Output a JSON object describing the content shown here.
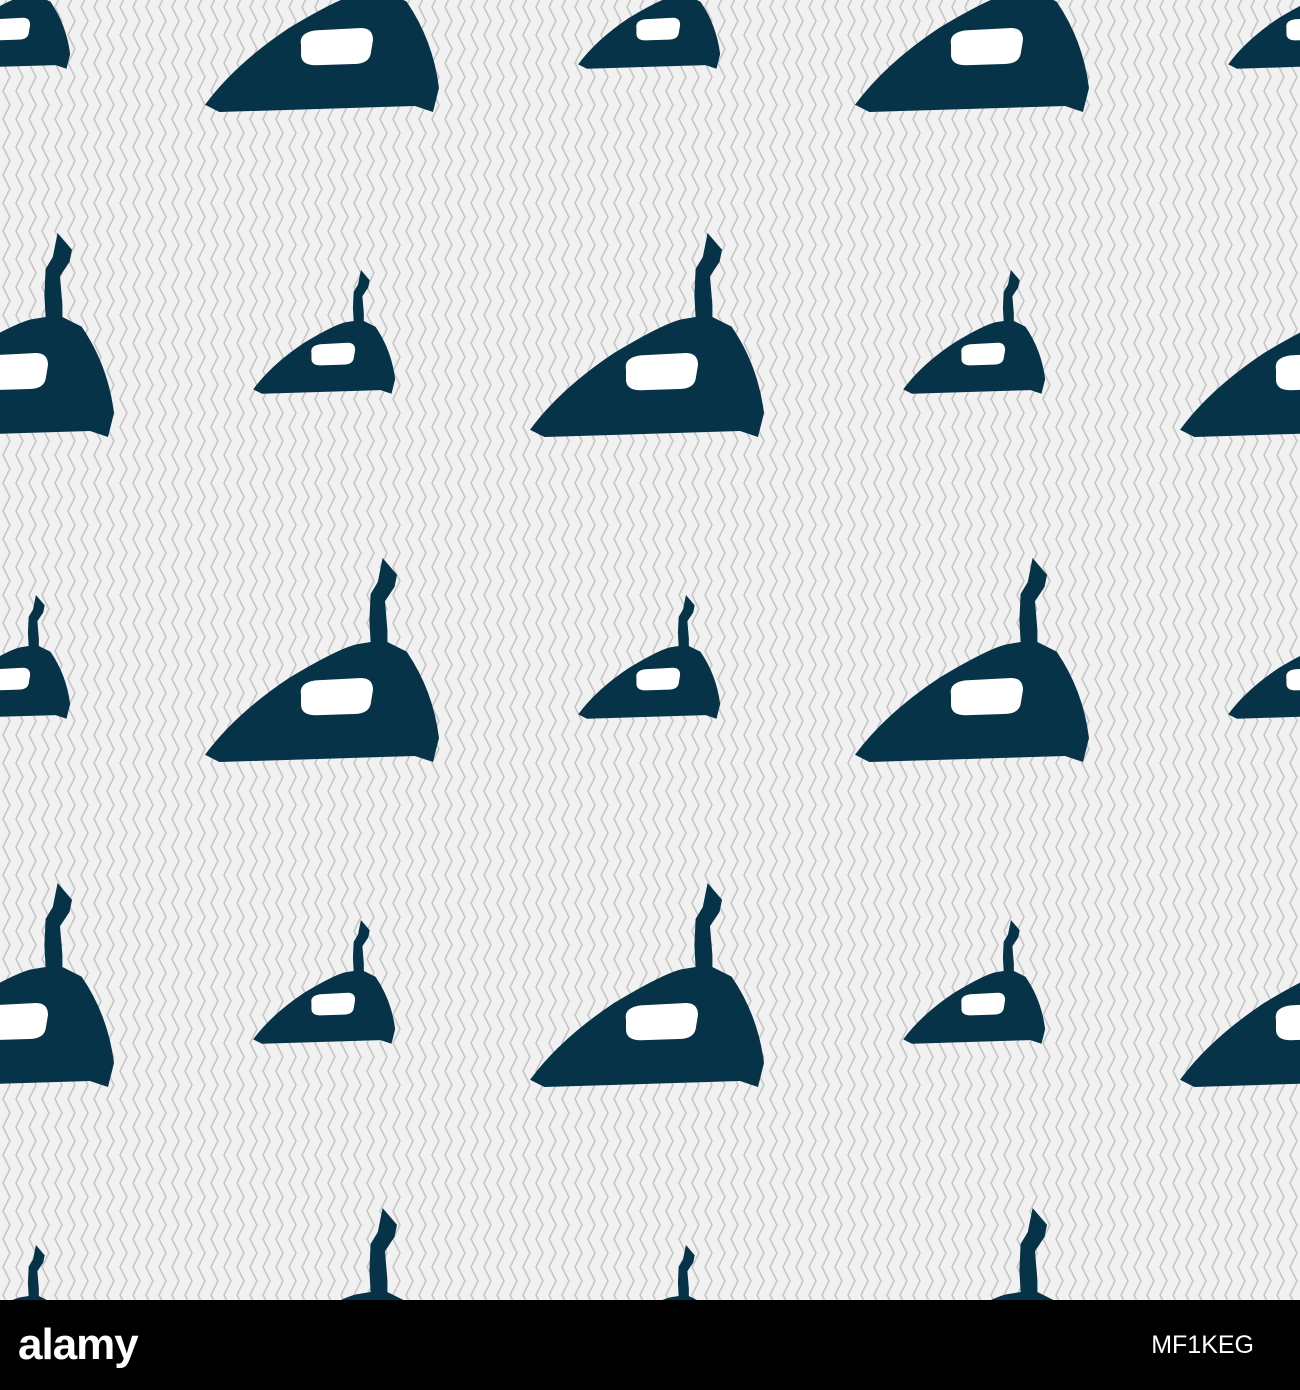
{
  "colors": {
    "background": "#f1f1f1",
    "zigzag_stroke": "#c6c6c6",
    "icon_fill": "#063348",
    "icon_window": "#ffffff",
    "footer_background": "#000000",
    "footer_text": "#ffffff"
  },
  "pattern": {
    "icon": "steam-iron-icon",
    "stripe_style": "zigzag"
  },
  "footer": {
    "brand": "alamy",
    "image_id": "MF1KEG"
  }
}
